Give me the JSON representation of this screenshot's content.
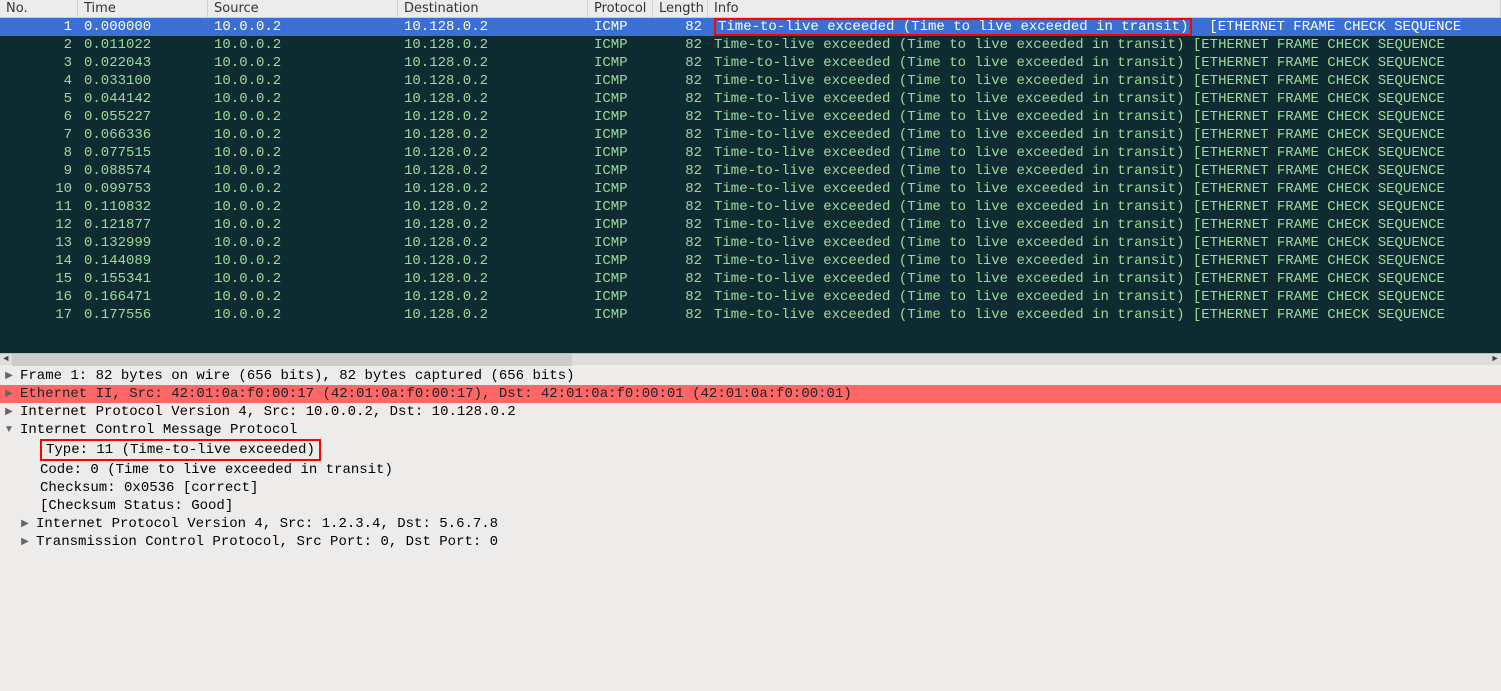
{
  "columns": {
    "no": "No.",
    "time": "Time",
    "source": "Source",
    "dest": "Destination",
    "proto": "Protocol",
    "len": "Length",
    "info": "Info"
  },
  "info_text": {
    "main": "Time-to-live exceeded (Time to live exceeded in transit)",
    "eth": "[ETHERNET FRAME CHECK SEQUENCE"
  },
  "packets": [
    {
      "no": 1,
      "time": "0.000000",
      "src": "10.0.0.2",
      "dst": "10.128.0.2",
      "proto": "ICMP",
      "len": 82,
      "selected": true
    },
    {
      "no": 2,
      "time": "0.011022",
      "src": "10.0.0.2",
      "dst": "10.128.0.2",
      "proto": "ICMP",
      "len": 82
    },
    {
      "no": 3,
      "time": "0.022043",
      "src": "10.0.0.2",
      "dst": "10.128.0.2",
      "proto": "ICMP",
      "len": 82
    },
    {
      "no": 4,
      "time": "0.033100",
      "src": "10.0.0.2",
      "dst": "10.128.0.2",
      "proto": "ICMP",
      "len": 82
    },
    {
      "no": 5,
      "time": "0.044142",
      "src": "10.0.0.2",
      "dst": "10.128.0.2",
      "proto": "ICMP",
      "len": 82
    },
    {
      "no": 6,
      "time": "0.055227",
      "src": "10.0.0.2",
      "dst": "10.128.0.2",
      "proto": "ICMP",
      "len": 82
    },
    {
      "no": 7,
      "time": "0.066336",
      "src": "10.0.0.2",
      "dst": "10.128.0.2",
      "proto": "ICMP",
      "len": 82
    },
    {
      "no": 8,
      "time": "0.077515",
      "src": "10.0.0.2",
      "dst": "10.128.0.2",
      "proto": "ICMP",
      "len": 82
    },
    {
      "no": 9,
      "time": "0.088574",
      "src": "10.0.0.2",
      "dst": "10.128.0.2",
      "proto": "ICMP",
      "len": 82
    },
    {
      "no": 10,
      "time": "0.099753",
      "src": "10.0.0.2",
      "dst": "10.128.0.2",
      "proto": "ICMP",
      "len": 82
    },
    {
      "no": 11,
      "time": "0.110832",
      "src": "10.0.0.2",
      "dst": "10.128.0.2",
      "proto": "ICMP",
      "len": 82
    },
    {
      "no": 12,
      "time": "0.121877",
      "src": "10.0.0.2",
      "dst": "10.128.0.2",
      "proto": "ICMP",
      "len": 82
    },
    {
      "no": 13,
      "time": "0.132999",
      "src": "10.0.0.2",
      "dst": "10.128.0.2",
      "proto": "ICMP",
      "len": 82
    },
    {
      "no": 14,
      "time": "0.144089",
      "src": "10.0.0.2",
      "dst": "10.128.0.2",
      "proto": "ICMP",
      "len": 82
    },
    {
      "no": 15,
      "time": "0.155341",
      "src": "10.0.0.2",
      "dst": "10.128.0.2",
      "proto": "ICMP",
      "len": 82
    },
    {
      "no": 16,
      "time": "0.166471",
      "src": "10.0.0.2",
      "dst": "10.128.0.2",
      "proto": "ICMP",
      "len": 82
    },
    {
      "no": 17,
      "time": "0.177556",
      "src": "10.0.0.2",
      "dst": "10.128.0.2",
      "proto": "ICMP",
      "len": 82
    }
  ],
  "tree": {
    "frame": "Frame 1: 82 bytes on wire (656 bits), 82 bytes captured (656 bits)",
    "eth": "Ethernet II, Src: 42:01:0a:f0:00:17 (42:01:0a:f0:00:17), Dst: 42:01:0a:f0:00:01 (42:01:0a:f0:00:01)",
    "ip": "Internet Protocol Version 4, Src: 10.0.0.2, Dst: 10.128.0.2",
    "icmp": "Internet Control Message Protocol",
    "type": "Type: 11 (Time-to-live exceeded)",
    "code": "Code: 0 (Time to live exceeded in transit)",
    "cksum": "Checksum: 0x0536 [correct]",
    "cksum_status": "[Checksum Status: Good]",
    "inner_ip": "Internet Protocol Version 4, Src: 1.2.3.4, Dst: 5.6.7.8",
    "inner_tcp": "Transmission Control Protocol, Src Port: 0, Dst Port: 0"
  },
  "twisty": {
    "closed": "▶",
    "open": "▼"
  }
}
